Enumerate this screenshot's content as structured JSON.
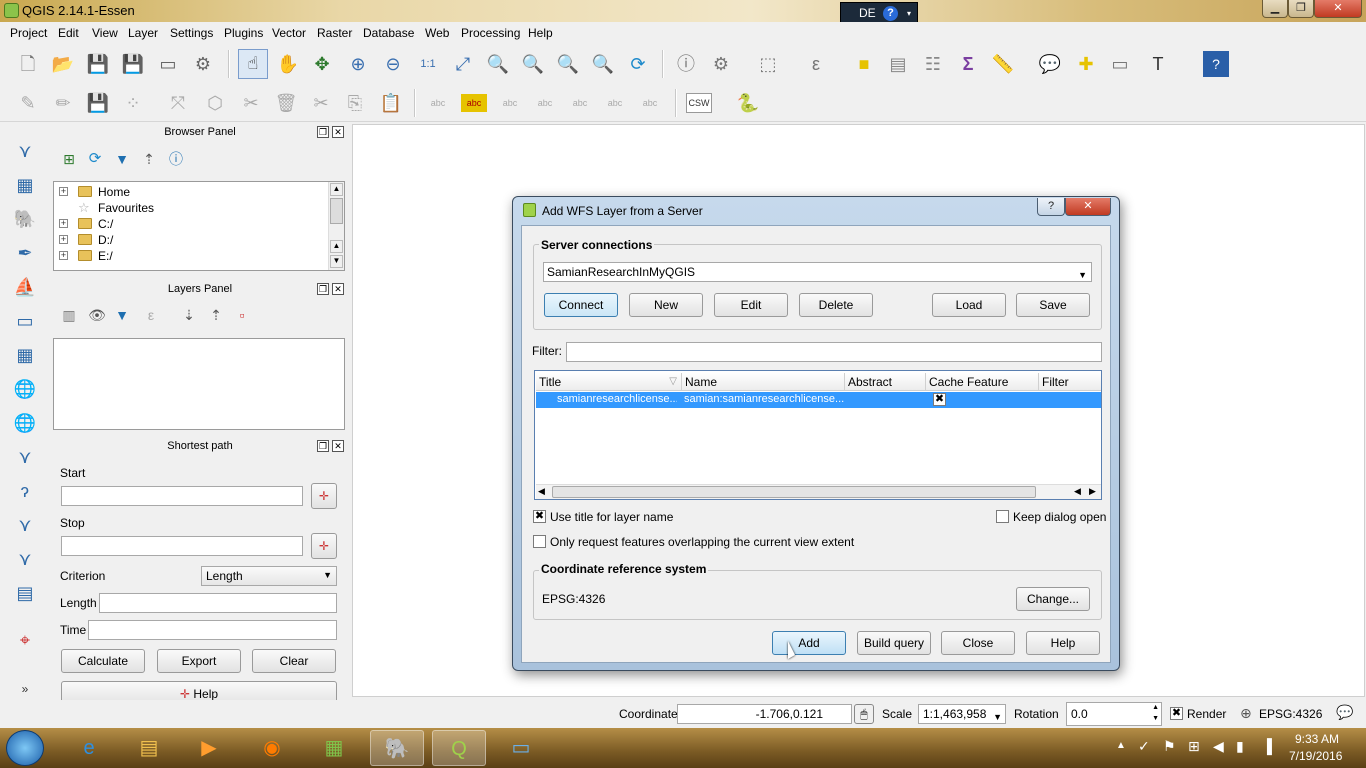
{
  "window": {
    "title": "QGIS 2.14.1-Essen",
    "lang": "DE",
    "help_glyph": "?",
    "min": "▁",
    "max": "❐",
    "close": "✕"
  },
  "menu": [
    "Project",
    "Edit",
    "View",
    "Layer",
    "Settings",
    "Plugins",
    "Vector",
    "Raster",
    "Database",
    "Web",
    "Processing",
    "Help"
  ],
  "toolbar2": {
    "csw_label": "CSW",
    "abc": "abc"
  },
  "browser_panel": {
    "title": "Browser Panel",
    "items": [
      {
        "label": "Home",
        "expandable": true
      },
      {
        "label": "Favourites",
        "expandable": false
      },
      {
        "label": "C:/",
        "expandable": true
      },
      {
        "label": "D:/",
        "expandable": true
      },
      {
        "label": "E:/",
        "expandable": true
      }
    ]
  },
  "layers_panel": {
    "title": "Layers Panel"
  },
  "shortest_path": {
    "title": "Shortest path",
    "start_label": "Start",
    "stop_label": "Stop",
    "criterion_label": "Criterion",
    "criterion_value": "Length",
    "length_label": "Length",
    "time_label": "Time",
    "calculate": "Calculate",
    "export": "Export",
    "clear": "Clear",
    "help": "Help"
  },
  "dialog": {
    "title": "Add WFS Layer from a Server",
    "help_glyph": "?",
    "server_group": "Server connections",
    "server_value": "SamianResearchInMyQGIS",
    "buttons": {
      "connect": "Connect",
      "new": "New",
      "edit": "Edit",
      "delete": "Delete",
      "load": "Load",
      "save": "Save"
    },
    "filter_label": "Filter:",
    "filter_value": "",
    "columns": [
      "Title",
      "Name",
      "Abstract",
      "Cache Feature",
      "Filter"
    ],
    "rows": [
      {
        "title": "samianresearchlicense...",
        "name": "samian:samianresearchlicense...",
        "abstract": "",
        "cache": true,
        "filter": ""
      }
    ],
    "use_title": "Use title for layer name",
    "use_title_checked": true,
    "keep_open": "Keep dialog open",
    "keep_open_checked": false,
    "only_request": "Only request features overlapping the current view extent",
    "only_request_checked": false,
    "crs_group": "Coordinate reference system",
    "crs_value": "EPSG:4326",
    "change": "Change...",
    "add": "Add",
    "build_query": "Build query",
    "close": "Close",
    "help": "Help"
  },
  "status": {
    "coordinate_label": "Coordinate",
    "coordinate_value": "-1.706,0.121",
    "scale_label": "Scale",
    "scale_value": "1:1,463,958",
    "rotation_label": "Rotation",
    "rotation_value": "0.0",
    "render_label": "Render",
    "render_checked": true,
    "epsg": "EPSG:4326"
  },
  "taskbar": {
    "time": "9:33 AM",
    "date": "7/19/2016"
  }
}
